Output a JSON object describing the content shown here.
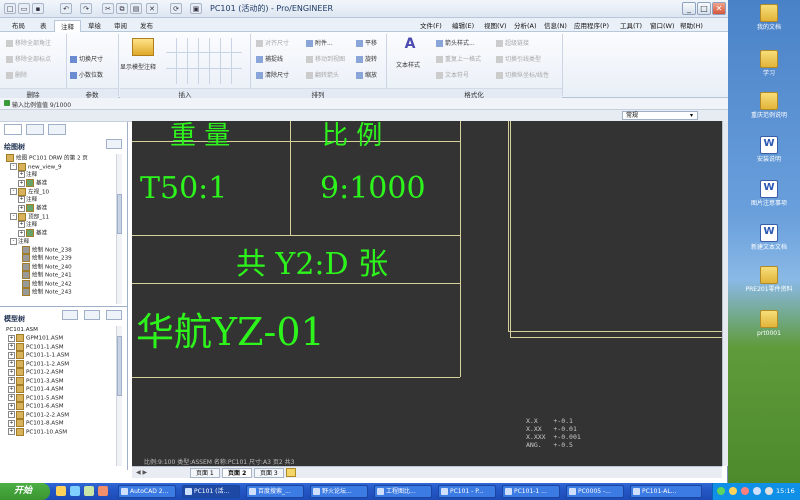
{
  "window": {
    "title": "PC101 (活动的) - Pro/ENGINEER",
    "menus": [
      "文件(F)",
      "编辑(E)",
      "视图(V)",
      "分析(A)",
      "信息(N)",
      "应用程序(P)",
      "工具(T)",
      "窗口(W)",
      "帮助(H)"
    ],
    "tabs": [
      "布局",
      "表",
      "注释",
      "草绘",
      "审阅",
      "发布"
    ],
    "active_tab": "注释"
  },
  "ribbon": {
    "delete_group": {
      "items": [
        "移除全部角注",
        "移除全部标点",
        "删除"
      ],
      "label": "删除"
    },
    "params_group": {
      "items": [
        "切换尺寸",
        "小数位数"
      ],
      "label": "参数"
    },
    "show_model": "显示模型注释",
    "insert_group": {
      "label": "插入"
    },
    "arrange_group": {
      "items": [
        "对齐尺寸",
        "捕捉线",
        "清除尺寸",
        "附件...",
        "移动到视图",
        "翻转箭头",
        "平移",
        "旋转",
        "缩放"
      ],
      "label": "排列"
    },
    "text_style": "文本样式",
    "format_group": {
      "items": [
        "箭头样式...",
        "重复上一格式",
        "文本符号",
        "超级链接",
        "切换引线类型",
        "切换纵坐标/线性"
      ],
      "label": "格式化"
    }
  },
  "status": {
    "message": "输入比例值值    9/1000",
    "view_select": "常规"
  },
  "drawing_tree": {
    "title": "绘图树",
    "items": [
      "绘图 PC101 DRW 的第 2 页",
      "new_view_9",
      "注释",
      "基准",
      "左视_10",
      "注释",
      "基准",
      "顶部_11",
      "注释",
      "基准",
      "注释",
      "绘制 Note_238",
      "绘制 Note_239",
      "绘制 Note_240",
      "绘制 Note_241",
      "绘制 Note_242",
      "绘制 Note_243"
    ]
  },
  "model_tree": {
    "title": "模型树",
    "items": [
      "PC101.ASM",
      "GPM101.ASM",
      "PC101-1.ASM",
      "PC101-1-1.ASM",
      "PC101-1-2.ASM",
      "PC101-2.ASM",
      "PC101-3.ASM",
      "PC101-4.ASM",
      "PC101-5.ASM",
      "PC101-6.ASM",
      "PC101-2-2.ASM",
      "PC101-8.ASM",
      "PC101-10.ASM"
    ]
  },
  "drawing": {
    "top_left": "重 量",
    "top_right": "比 例",
    "weight": "T50:1",
    "scale": "9:1000",
    "sheets_text": "共 Y2:D 张",
    "title_block": "华航YZ-01",
    "tolerances": [
      "X.X    +-0.1",
      "X.XX   +-0.01",
      "X.XXX  +-0.001",
      "ANG.   +-0.5"
    ],
    "bottom_info": "比例:9:100  类型:ASSEM  名称:PC101  尺寸:A3  页2 共3"
  },
  "sheet_tabs": [
    "页面 1",
    "页面 2",
    "页面 3"
  ],
  "active_sheet": "页面 2",
  "desktop_icons": [
    "我的文档",
    "学习",
    "重庆范例说明",
    "安装说明",
    "图片注意事项",
    "新建文本文档",
    "PRE201零件资料",
    "prt0001"
  ],
  "taskbar": {
    "start": "开始",
    "items": [
      "AutoCAD 2...",
      "PC101 (活...",
      "百度搜索_...",
      "野火论坛...",
      "工程图比...",
      "PC101 - P...",
      "PC101-1 ...",
      "PC0005 -...",
      "PC101-AL..."
    ],
    "clock": "15:16"
  },
  "colors": {
    "cad_text": "#2df51c",
    "cad_bg": "#333333",
    "frame_line": "#d6d09a"
  }
}
